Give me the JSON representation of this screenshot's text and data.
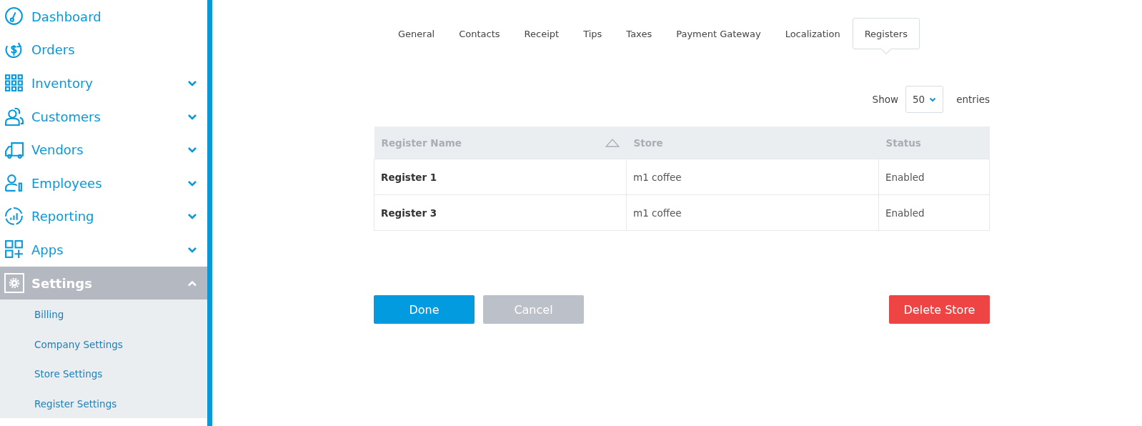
{
  "sidebar": {
    "items": [
      {
        "label": "Dashboard",
        "kind": "link",
        "selected": false
      },
      {
        "label": "Orders",
        "kind": "link",
        "selected": false
      },
      {
        "label": "Inventory",
        "kind": "group",
        "selected": false,
        "expanded": false
      },
      {
        "label": "Customers",
        "kind": "group",
        "selected": false,
        "expanded": false
      },
      {
        "label": "Vendors",
        "kind": "group",
        "selected": false,
        "expanded": false
      },
      {
        "label": "Employees",
        "kind": "group",
        "selected": false,
        "expanded": false
      },
      {
        "label": "Reporting",
        "kind": "group",
        "selected": false,
        "expanded": false
      },
      {
        "label": "Apps",
        "kind": "group",
        "selected": false,
        "expanded": false
      },
      {
        "label": "Settings",
        "kind": "group",
        "selected": true,
        "expanded": true,
        "children": [
          {
            "label": "Billing",
            "selected": false
          },
          {
            "label": "Company Settings",
            "selected": false
          },
          {
            "label": "Store Settings",
            "selected": false
          },
          {
            "label": "Register Settings",
            "selected": false
          }
        ]
      }
    ]
  },
  "tabs": [
    {
      "label": "General",
      "selected": false
    },
    {
      "label": "Contacts",
      "selected": false
    },
    {
      "label": "Receipt",
      "selected": false
    },
    {
      "label": "Tips",
      "selected": false
    },
    {
      "label": "Taxes",
      "selected": false
    },
    {
      "label": "Payment Gateway",
      "selected": false
    },
    {
      "label": "Localization",
      "selected": false
    },
    {
      "label": "Registers",
      "selected": true
    }
  ],
  "page_size": {
    "label_before": "Show",
    "value": "50",
    "label_after": "entries"
  },
  "table": {
    "columns": [
      {
        "label": "Register Name",
        "sorted": true
      },
      {
        "label": "Store",
        "sorted": false
      },
      {
        "label": "Status",
        "sorted": false
      }
    ],
    "rows": [
      [
        "Register 1",
        "m1 coffee",
        "Enabled"
      ],
      [
        "Register 3",
        "m1 coffee",
        "Enabled"
      ]
    ]
  },
  "buttons": [
    {
      "label": "Done",
      "kind": "primary"
    },
    {
      "label": "Cancel",
      "kind": "secondary"
    },
    {
      "label": "Delete Store",
      "kind": "danger"
    }
  ]
}
